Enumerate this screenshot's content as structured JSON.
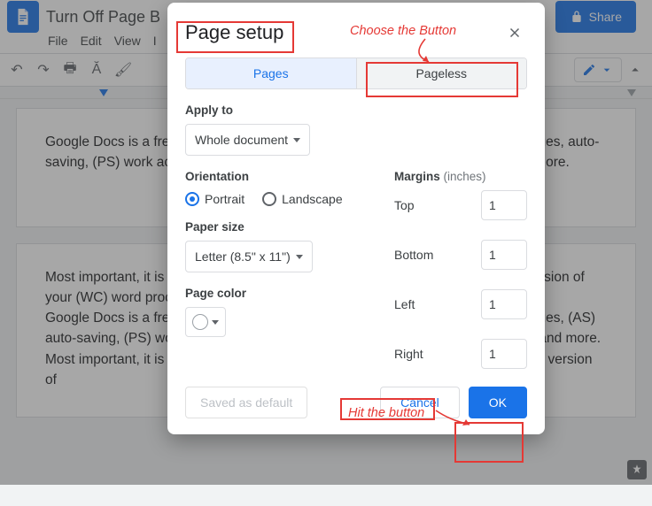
{
  "doc": {
    "title": "Turn Off Page B",
    "menus": [
      "File",
      "Edit",
      "View",
      "I"
    ],
    "share": "Share",
    "body1": "Google Docs is a free browser-based word processor. It lets you (WC) track changes, auto-saving, (PS) work across devices, (PS) easily share work, (FS) free storage and more.",
    "body2": "Most important, it is the design of the Pageless format that turn off most recent version of your (WC) word processor in which (AS) is a web application.\nGoogle Docs is a free browser-based word processor. It lets you (WC) track changes, (AS) auto-saving, (PS) work across devices, (PS) easily share work, (FS) free storage and more. Most important, it is the design of the Pageless format that turn off the most recent version of"
  },
  "dialog": {
    "title": "Page setup",
    "tabs": {
      "pages": "Pages",
      "pageless": "Pageless"
    },
    "apply_to_label": "Apply to",
    "apply_to_value": "Whole document",
    "orientation_label": "Orientation",
    "orientation": {
      "portrait": "Portrait",
      "landscape": "Landscape"
    },
    "paper_size_label": "Paper size",
    "paper_size_value": "Letter (8.5\" x 11\")",
    "page_color_label": "Page color",
    "margins_label": "Margins",
    "margins_unit": "(inches)",
    "margins": {
      "top_label": "Top",
      "top_value": "1",
      "bottom_label": "Bottom",
      "bottom_value": "1",
      "left_label": "Left",
      "left_value": "1",
      "right_label": "Right",
      "right_value": "1"
    },
    "saved_default": "Saved as default",
    "cancel": "Cancel",
    "ok": "OK"
  },
  "callouts": {
    "choose": "Choose the Button",
    "hit": "Hit the button"
  }
}
